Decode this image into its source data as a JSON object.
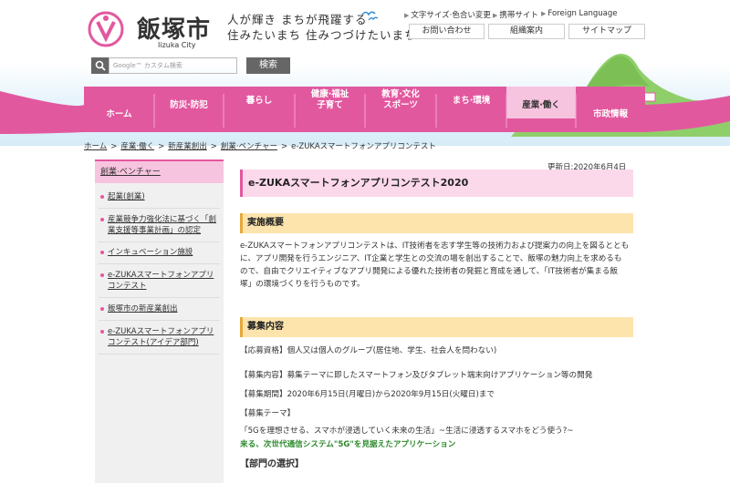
{
  "header": {
    "city_name": "飯塚市",
    "city_roman": "Iizuka City",
    "slogan_line1": "人が輝き まちが飛躍する",
    "slogan_line2": "住みたいまち 住みつづけたいまち",
    "util_links": [
      "文字サイズ·色合い変更",
      "携帯サイト",
      "Foreign Language"
    ],
    "buttons": [
      "お問い合わせ",
      "組織案内",
      "サイトマップ"
    ],
    "search_placeholder": "Google™ カスタム検索",
    "search_label": "検索",
    "brand_color": "#e2589f"
  },
  "nav": {
    "items": [
      "ホーム",
      "防災·防犯",
      "暮らし",
      "健康·福祉\n子育て",
      "教育·文化\nスポーツ",
      "まち·環境",
      "産業·働く",
      "市政情報"
    ],
    "active_index": 6
  },
  "breadcrumb": [
    "ホーム",
    "産業·働く",
    "新産業創出",
    "創業·ベンチャー",
    "e-ZUKAスマートフォンアプリコンテスト"
  ],
  "sidebar": {
    "heading": "創業·ベンチャー",
    "items": [
      "起業(創業)",
      "産業競争力強化法に基づく「創業支援等事業計画」の認定",
      "インキュベーション施設",
      "e-ZUKAスマートフォンアプリコンテスト",
      "飯塚市の新産業創出",
      "e-ZUKAスマートフォンアプリコンテスト(アイデア部門)"
    ]
  },
  "main": {
    "updated": "更新日:2020年6月4日",
    "title": "e-ZUKAスマートフォンアプリコンテスト2020",
    "section1": "実施概要",
    "overview": [
      "e-ZUKAスマートフォンアプリコンテストは、IT技術者を志す学生等の技術力および提案力の向上を図るととも",
      "に、アプリ開発を行うエンジニア、IT企業と学生との交流の場を創出することで、飯塚の魅力向上を求めるも",
      "ので、自由でクリエイティブなアプリ開発による優れた技術者の発掘と育成を通して、「IT技術者が集まる飯",
      "塚」の環境づくりを行うものです。"
    ],
    "section2": "募集内容",
    "eligibility": "【応募資格】個人又は個人のグループ(居住地、学生、社会人を問わない)",
    "content": "【募集内容】募集テーマに即したスマートフォン及びタブレット端末向けアプリケーション等の開発",
    "period": "【募集期間】2020年6月15日(月曜日)から2020年9月15日(火曜日)まで",
    "theme_label": "【募集テーマ】",
    "theme_line1": "「5Gを理想させる、スマホが浸透していく未来の生活」~生活に浸透するスマホをどう使う?~",
    "theme_line2": "来る、次世代通信システム\"5G\"を見据えたアプリケーション",
    "division": "【部門の選択】"
  }
}
